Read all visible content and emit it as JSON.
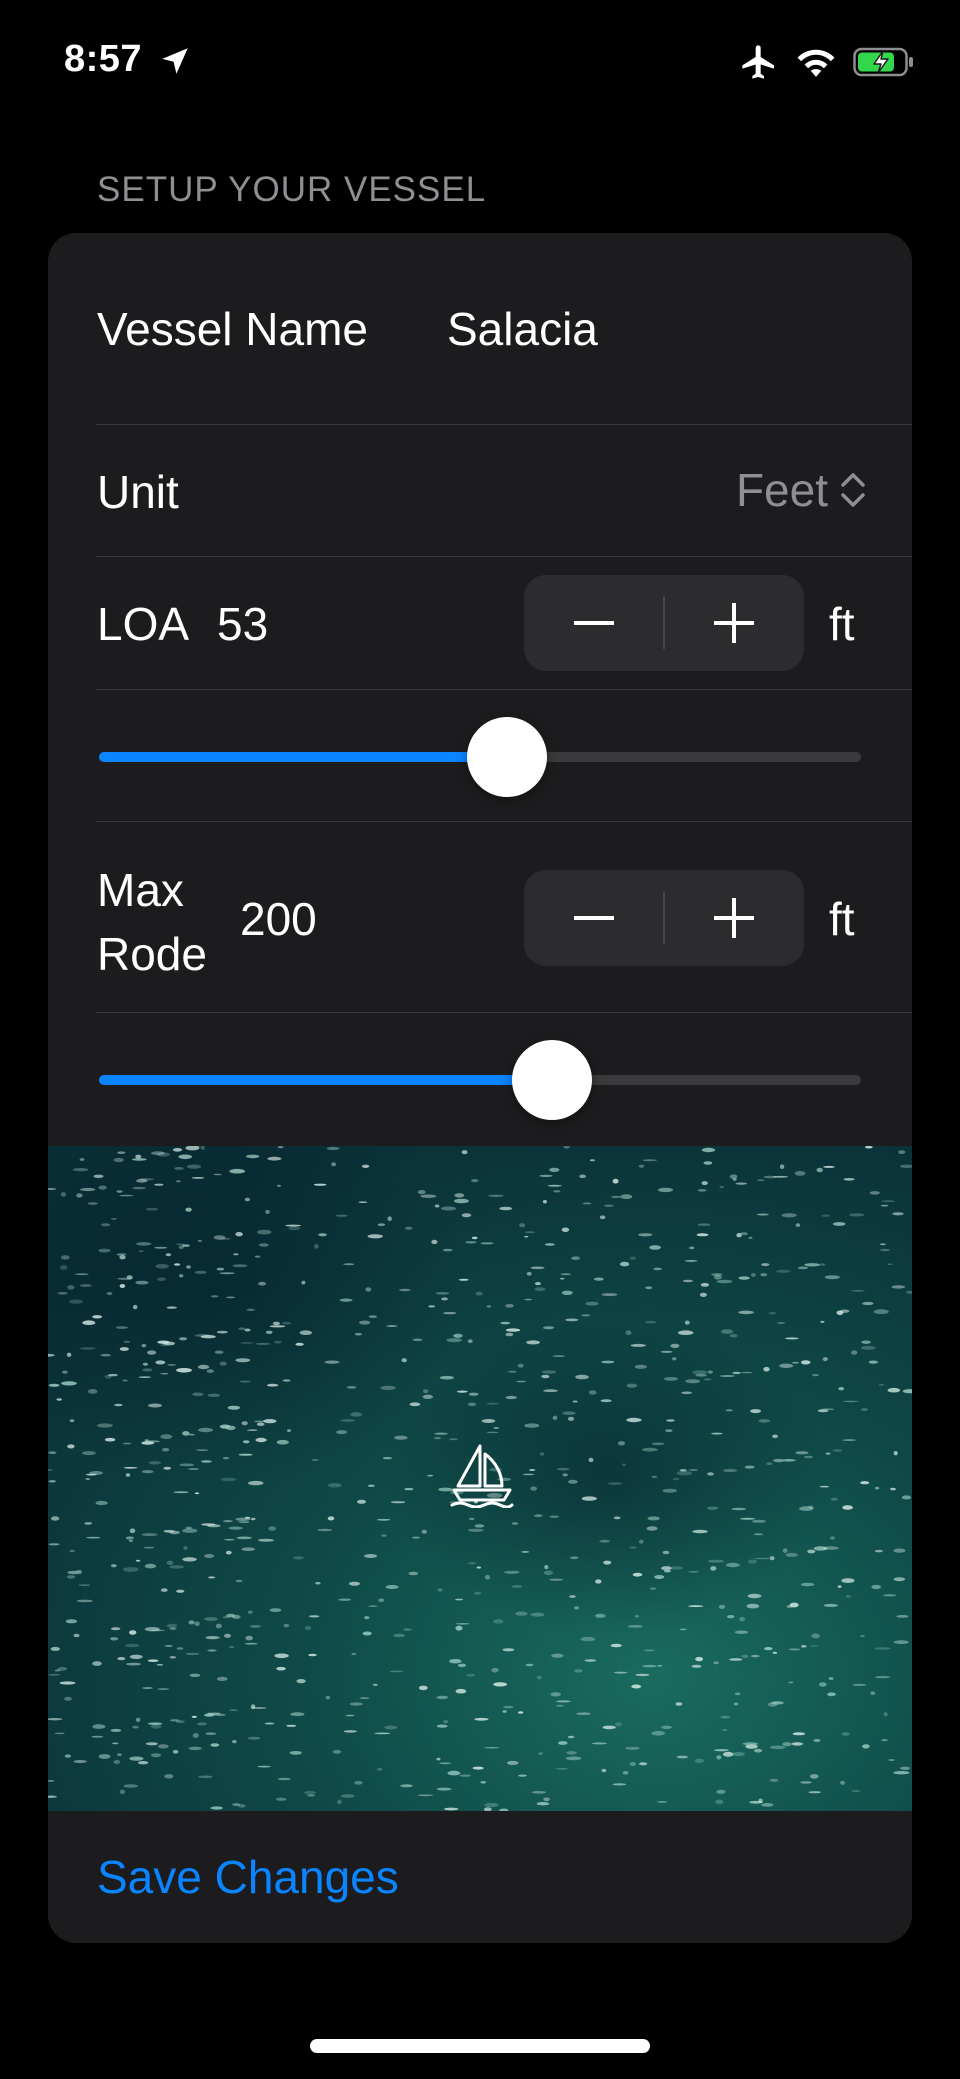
{
  "status_bar": {
    "time": "8:57",
    "icons": [
      "location-arrow-icon",
      "airplane-icon",
      "wifi-icon",
      "battery-charging-icon"
    ],
    "battery_color": "#32d74b"
  },
  "section": {
    "header": "SETUP YOUR VESSEL"
  },
  "vessel_name": {
    "label": "Vessel Name",
    "value": "Salacia"
  },
  "unit": {
    "label": "Unit",
    "selected": "Feet"
  },
  "loa": {
    "label": "LOA",
    "value": "53",
    "unit": "ft",
    "slider_fraction": 0.535
  },
  "max_rode": {
    "label_line1": "Max",
    "label_line2": "Rode",
    "value": "200",
    "unit": "ft",
    "slider_fraction": 0.595
  },
  "map": {
    "marker_icon": "sailboat-icon"
  },
  "actions": {
    "save_label": "Save Changes"
  },
  "colors": {
    "accent": "#0a84ff",
    "card_background": "#1c1c1e",
    "secondary_text": "#8e8e93"
  }
}
